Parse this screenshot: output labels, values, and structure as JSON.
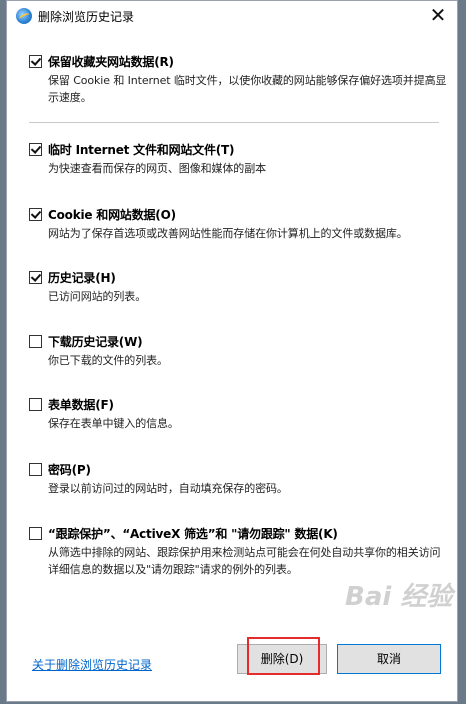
{
  "window": {
    "title": "删除浏览历史记录",
    "close_glyph": "✕",
    "icon": "ie-icon"
  },
  "items": [
    {
      "label": "保留收藏夹网站数据(R)",
      "checked": true,
      "desc": "保留 Cookie 和 Internet 临时文件，以使你收藏的网站能够保存偏好选项并提高显示速度。"
    },
    {
      "label": "临时 Internet 文件和网站文件(T)",
      "checked": true,
      "desc": "为快速查看而保存的网页、图像和媒体的副本"
    },
    {
      "label": "Cookie 和网站数据(O)",
      "checked": true,
      "desc": "网站为了保存首选项或改善网站性能而存储在你计算机上的文件或数据库。"
    },
    {
      "label": "历史记录(H)",
      "checked": true,
      "desc": "已访问网站的列表。"
    },
    {
      "label": "下载历史记录(W)",
      "checked": false,
      "desc": "你已下载的文件的列表。"
    },
    {
      "label": "表单数据(F)",
      "checked": false,
      "desc": "保存在表单中键入的信息。"
    },
    {
      "label": "密码(P)",
      "checked": false,
      "desc": "登录以前访问过的网站时，自动填充保存的密码。"
    },
    {
      "label": "“跟踪保护”、“ActiveX 筛选”和 \"请勿跟踪\" 数据(K)",
      "checked": false,
      "desc": "从筛选中排除的网站、跟踪保护用来检测站点可能会在何处自动共享你的相关访问详细信息的数据以及\"请勿跟踪\"请求的例外的列表。"
    }
  ],
  "footer": {
    "link": "关于删除浏览历史记录",
    "delete_button": "删除(D)",
    "cancel_button": "取消"
  },
  "watermark": "Bai 经验",
  "colors": {
    "link": "#0066cc",
    "highlight": "#e52b2b"
  }
}
